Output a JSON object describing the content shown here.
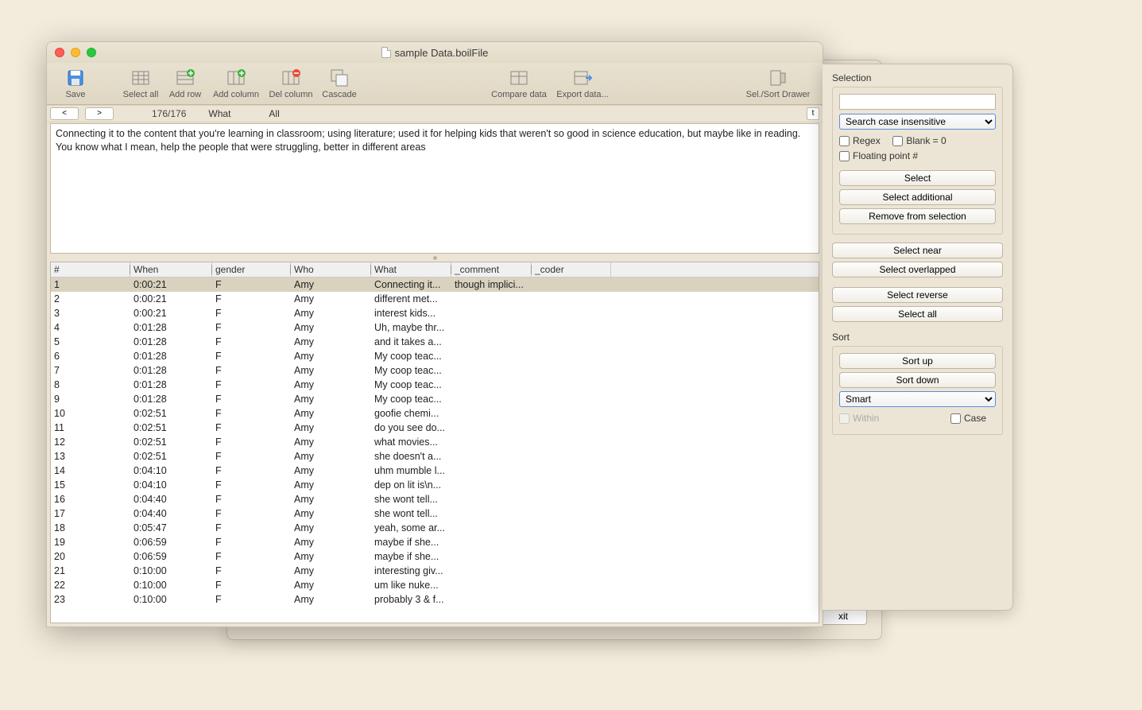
{
  "bgWindow": {
    "exitLabel": "xit"
  },
  "window": {
    "title": "sample Data.boilFile"
  },
  "toolbar": {
    "save": "Save",
    "selectAll": "Select all",
    "addRow": "Add row",
    "addCol": "Add column",
    "delCol": "Del column",
    "cascade": "Cascade",
    "compare": "Compare data",
    "export": "Export data...",
    "drawer": "Sel./Sort Drawer"
  },
  "searchbar": {
    "prev": "<",
    "next": ">",
    "count": "176/176",
    "field": "What",
    "scope": "All",
    "t": "t"
  },
  "detailText": "Connecting it  to the content that you're learning in classroom; using literature; used it for helping kids that weren't so good in science education, but maybe like in reading. You know what I mean, help the people that were struggling, better in different areas",
  "columns": [
    "#",
    "When",
    "gender",
    "Who",
    "What",
    "_comment",
    "_coder"
  ],
  "rows": [
    {
      "n": "1",
      "when": "0:00:21",
      "g": "F",
      "who": "Amy",
      "what": "Connecting it...",
      "comment": "though implici...",
      "coder": ""
    },
    {
      "n": "2",
      "when": "0:00:21",
      "g": "F",
      "who": "Amy",
      "what": "different met...",
      "comment": "",
      "coder": ""
    },
    {
      "n": "3",
      "when": "0:00:21",
      "g": "F",
      "who": "Amy",
      "what": "interest kids...",
      "comment": "",
      "coder": ""
    },
    {
      "n": "4",
      "when": "0:01:28",
      "g": "F",
      "who": "Amy",
      "what": "Uh, maybe thr...",
      "comment": "",
      "coder": ""
    },
    {
      "n": "5",
      "when": "0:01:28",
      "g": "F",
      "who": "Amy",
      "what": " and it takes a...",
      "comment": "",
      "coder": ""
    },
    {
      "n": "6",
      "when": "0:01:28",
      "g": "F",
      "who": "Amy",
      "what": "My coop teac...",
      "comment": "",
      "coder": ""
    },
    {
      "n": "7",
      "when": "0:01:28",
      "g": "F",
      "who": "Amy",
      "what": "My coop teac...",
      "comment": "",
      "coder": ""
    },
    {
      "n": "8",
      "when": "0:01:28",
      "g": "F",
      "who": "Amy",
      "what": "My coop teac...",
      "comment": "",
      "coder": ""
    },
    {
      "n": "9",
      "when": "0:01:28",
      "g": "F",
      "who": "Amy",
      "what": "My coop teac...",
      "comment": "",
      "coder": ""
    },
    {
      "n": "10",
      "when": "0:02:51",
      "g": "F",
      "who": "Amy",
      "what": " goofie chemi...",
      "comment": "",
      "coder": ""
    },
    {
      "n": "11",
      "when": "0:02:51",
      "g": "F",
      "who": "Amy",
      "what": "do you see do...",
      "comment": "",
      "coder": ""
    },
    {
      "n": "12",
      "when": "0:02:51",
      "g": "F",
      "who": "Amy",
      "what": "what movies...",
      "comment": "",
      "coder": ""
    },
    {
      "n": "13",
      "when": "0:02:51",
      "g": "F",
      "who": "Amy",
      "what": "she doesn't a...",
      "comment": "",
      "coder": ""
    },
    {
      "n": "14",
      "when": "0:04:10",
      "g": "F",
      "who": "Amy",
      "what": "uhm mumble l...",
      "comment": "",
      "coder": ""
    },
    {
      "n": "15",
      "when": "0:04:10",
      "g": "F",
      "who": "Amy",
      "what": "dep on lit is\\n...",
      "comment": "",
      "coder": ""
    },
    {
      "n": "16",
      "when": "0:04:40",
      "g": "F",
      "who": "Amy",
      "what": "she wont tell...",
      "comment": "",
      "coder": ""
    },
    {
      "n": "17",
      "when": "0:04:40",
      "g": "F",
      "who": "Amy",
      "what": "she wont tell...",
      "comment": "",
      "coder": ""
    },
    {
      "n": "18",
      "when": "0:05:47",
      "g": "F",
      "who": "Amy",
      "what": "yeah, some ar...",
      "comment": "",
      "coder": ""
    },
    {
      "n": "19",
      "when": "0:06:59",
      "g": "F",
      "who": "Amy",
      "what": "maybe if she...",
      "comment": "",
      "coder": ""
    },
    {
      "n": "20",
      "when": "0:06:59",
      "g": "F",
      "who": "Amy",
      "what": "maybe if she...",
      "comment": "",
      "coder": ""
    },
    {
      "n": "21",
      "when": "0:10:00",
      "g": "F",
      "who": "Amy",
      "what": "interesting giv...",
      "comment": "",
      "coder": ""
    },
    {
      "n": "22",
      "when": "0:10:00",
      "g": "F",
      "who": "Amy",
      "what": "um like nuke...",
      "comment": "",
      "coder": ""
    },
    {
      "n": "23",
      "when": "0:10:00",
      "g": "F",
      "who": "Amy",
      "what": "probably 3 & f...",
      "comment": "",
      "coder": ""
    }
  ],
  "drawer": {
    "selectionHeader": "Selection",
    "searchMode": "Search case insensitive",
    "regex": "Regex",
    "blank0": "Blank = 0",
    "float": "Floating point #",
    "select": "Select",
    "selectAdd": "Select additional",
    "removeSel": "Remove from selection",
    "selectNear": "Select near",
    "selectOverlap": "Select overlapped",
    "selectReverse": "Select reverse",
    "selectAll": "Select all",
    "sortHeader": "Sort",
    "sortUp": "Sort up",
    "sortDown": "Sort down",
    "sortMode": "Smart",
    "within": "Within",
    "case": "Case"
  }
}
